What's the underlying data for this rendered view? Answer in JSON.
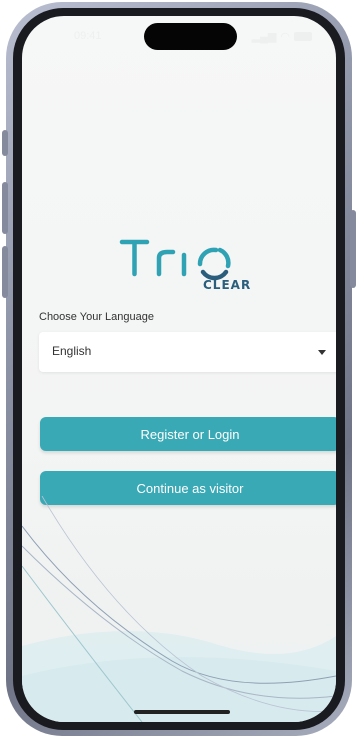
{
  "status_bar": {
    "time": "09:41"
  },
  "logo": {
    "main_text": "TRIO",
    "sub_text": "CLEAR"
  },
  "language": {
    "label": "Choose Your Language",
    "selected": "English"
  },
  "buttons": {
    "register_login": "Register or Login",
    "visitor": "Continue as visitor"
  },
  "colors": {
    "accent": "#3aa9b6",
    "logo_teal": "#2fa2b4",
    "logo_blue": "#2a5e7c",
    "background": "#f4f5f5"
  }
}
